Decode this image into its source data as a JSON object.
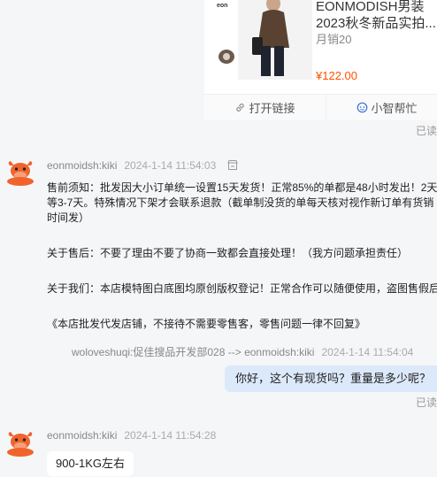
{
  "product": {
    "title_line1": "EONMODISH男装",
    "title_line2": "2023秋冬新品实拍...",
    "sales": "月销20",
    "price": "¥122.00",
    "image_brand": "eon",
    "open_link_label": "打开链接",
    "helper_label": "小智帮忙"
  },
  "read_label": "已读",
  "messages": [
    {
      "sender": "eonmoidsh:kiki",
      "time": "2024-1-14 11:54:03",
      "paragraphs": [
        "售前须知：批发因大小订单统一设置15天发货！正常85%的单都是48小时发出！2天",
        "等3-7天。特殊情况下架才会联系退款（截单制没货的单每天核对视作新订单有货销",
        "时间发）",
        "关于售后：不要了理由不要了协商一致都会直接处理！（我方问题承担责任）",
        "关于我们：本店模特图白底图均原创版权登记！正常合作可以随便使用，盗图售假后",
        "《本店批发代发店铺，不接待不需要零售客，零售问题一律不回复》"
      ]
    },
    {
      "transfer": "woloveshuqi:促佳搜品开发部028 --> eonmoidsh:kiki",
      "time": "2024-1-14 11:54:04",
      "text": "你好，这个有现货吗？重量是多少呢？"
    },
    {
      "sender": "eonmoidsh:kiki",
      "time": "2024-1-14 11:54:28",
      "text": "900-1KG左右"
    }
  ],
  "colors": {
    "price": "#ff5000",
    "bubble_self": "#dce9fb",
    "accent": "#3b6fd8",
    "avatar": "#f0642c"
  }
}
